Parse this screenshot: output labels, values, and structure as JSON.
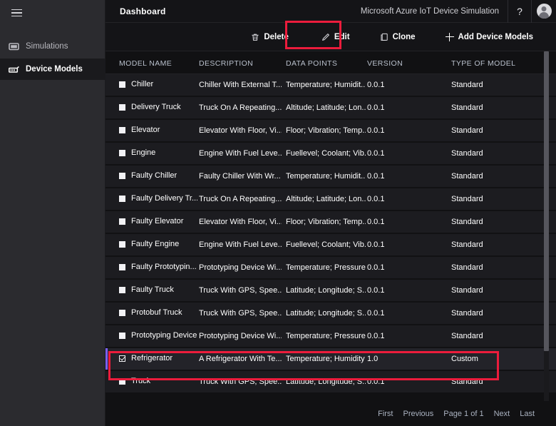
{
  "sidebar": {
    "menu_icon": "hamburger-icon",
    "items": [
      {
        "label": "Simulations",
        "icon": "monitor-icon",
        "active": false
      },
      {
        "label": "Device Models",
        "icon": "device-icon",
        "active": true
      }
    ]
  },
  "header": {
    "title": "Dashboard",
    "product": "Microsoft Azure IoT Device Simulation",
    "help_label": "?",
    "avatar": "user-avatar-icon"
  },
  "toolbar": {
    "delete_label": "Delete",
    "edit_label": "Edit",
    "clone_label": "Clone",
    "add_label": "Add Device Models"
  },
  "table": {
    "columns": [
      "MODEL NAME",
      "DESCRIPTION",
      "DATA POINTS",
      "VERSION",
      "TYPE OF MODEL"
    ],
    "rows": [
      {
        "name": "Chiller",
        "description": "Chiller With External T...",
        "data_points": "Temperature; Humidit...",
        "version": "0.0.1",
        "type": "Standard",
        "checked": false,
        "selected": false
      },
      {
        "name": "Delivery Truck",
        "description": "Truck On A Repeating...",
        "data_points": "Altitude; Latitude; Lon...",
        "version": "0.0.1",
        "type": "Standard",
        "checked": false,
        "selected": false
      },
      {
        "name": "Elevator",
        "description": "Elevator With Floor, Vi...",
        "data_points": "Floor; Vibration; Temp...",
        "version": "0.0.1",
        "type": "Standard",
        "checked": false,
        "selected": false
      },
      {
        "name": "Engine",
        "description": "Engine With Fuel Leve...",
        "data_points": "Fuellevel; Coolant; Vib...",
        "version": "0.0.1",
        "type": "Standard",
        "checked": false,
        "selected": false
      },
      {
        "name": "Faulty Chiller",
        "description": "Faulty Chiller With Wr...",
        "data_points": "Temperature; Humidit...",
        "version": "0.0.1",
        "type": "Standard",
        "checked": false,
        "selected": false
      },
      {
        "name": "Faulty Delivery Tr...",
        "description": "Truck On A Repeating...",
        "data_points": "Altitude; Latitude; Lon...",
        "version": "0.0.1",
        "type": "Standard",
        "checked": false,
        "selected": false
      },
      {
        "name": "Faulty Elevator",
        "description": "Elevator With Floor, Vi...",
        "data_points": "Floor; Vibration; Temp...",
        "version": "0.0.1",
        "type": "Standard",
        "checked": false,
        "selected": false
      },
      {
        "name": "Faulty Engine",
        "description": "Engine With Fuel Leve...",
        "data_points": "Fuellevel; Coolant; Vib...",
        "version": "0.0.1",
        "type": "Standard",
        "checked": false,
        "selected": false
      },
      {
        "name": "Faulty Prototypin...",
        "description": "Prototyping Device Wi...",
        "data_points": "Temperature; Pressure...",
        "version": "0.0.1",
        "type": "Standard",
        "checked": false,
        "selected": false
      },
      {
        "name": "Faulty Truck",
        "description": "Truck With GPS, Spee...",
        "data_points": "Latitude; Longitude; S...",
        "version": "0.0.1",
        "type": "Standard",
        "checked": false,
        "selected": false
      },
      {
        "name": "Protobuf Truck",
        "description": "Truck With GPS, Spee...",
        "data_points": "Latitude; Longitude; S...",
        "version": "0.0.1",
        "type": "Standard",
        "checked": false,
        "selected": false
      },
      {
        "name": "Prototyping Device",
        "description": "Prototyping Device Wi...",
        "data_points": "Temperature; Pressure...",
        "version": "0.0.1",
        "type": "Standard",
        "checked": false,
        "selected": false
      },
      {
        "name": "Refrigerator",
        "description": "A Refrigerator With Te...",
        "data_points": "Temperature; Humidity",
        "version": "1.0",
        "type": "Custom",
        "checked": true,
        "selected": true
      },
      {
        "name": "Truck",
        "description": "Truck With GPS, Spee...",
        "data_points": "Latitude; Longitude; S...",
        "version": "0.0.1",
        "type": "Standard",
        "checked": false,
        "selected": false
      }
    ]
  },
  "pagination": {
    "first": "First",
    "previous": "Previous",
    "page_info": "Page 1 of 1",
    "next": "Next",
    "last": "Last"
  },
  "annotations": {
    "highlight_color": "#ec1c3c",
    "boxes": [
      "delete-button",
      "refrigerator-row"
    ]
  },
  "colors": {
    "selected_accent": "#7b61ff",
    "sidebar_bg": "#2b2b2f",
    "row_bg": "#1c1c20"
  }
}
